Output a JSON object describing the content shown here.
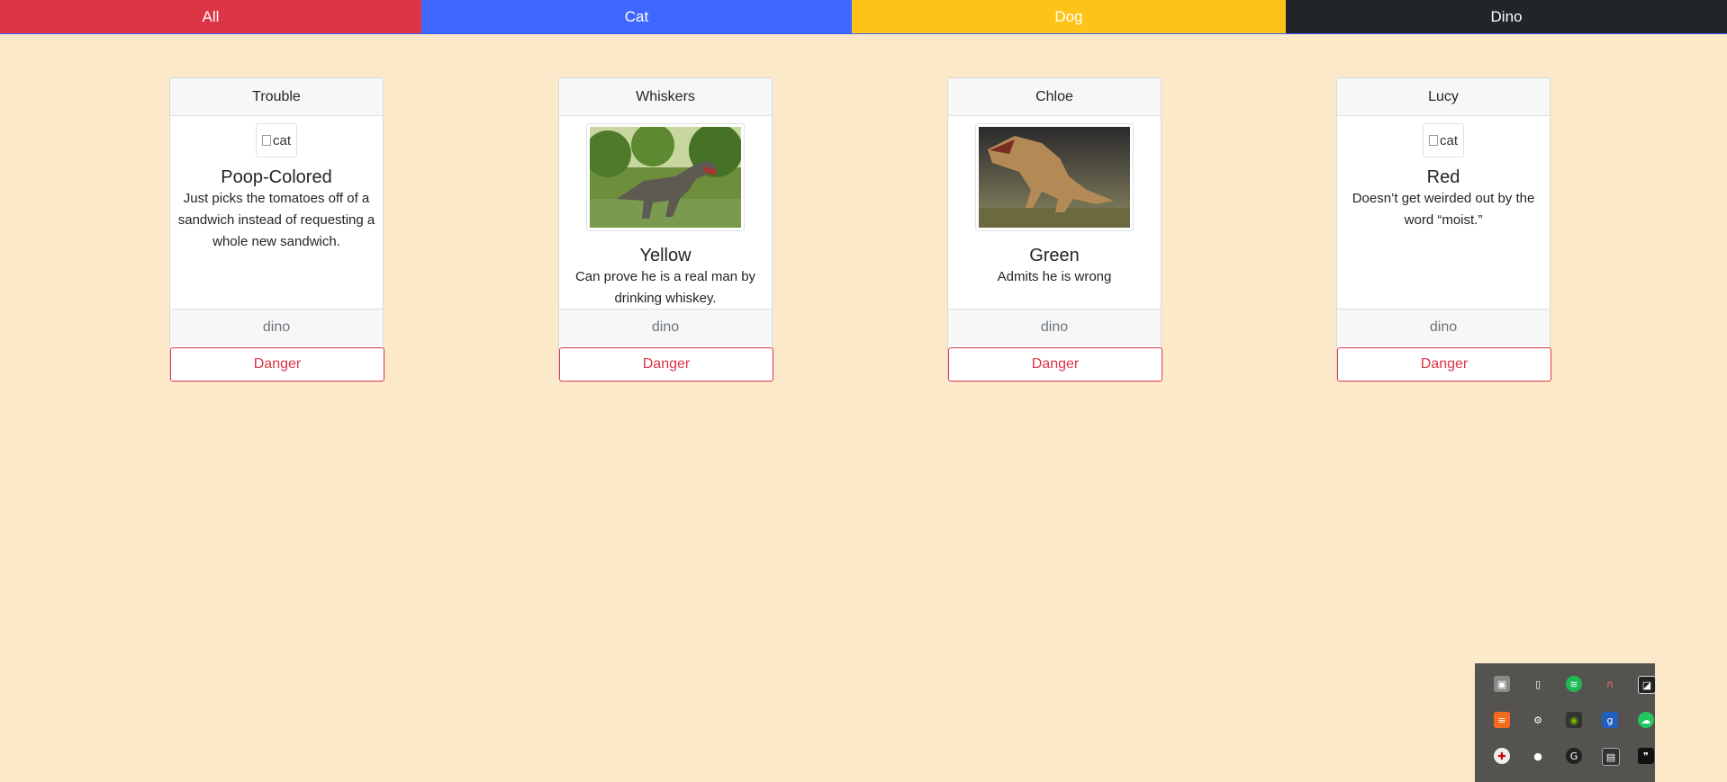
{
  "nav": {
    "all": "All",
    "cat": "Cat",
    "dog": "Dog",
    "dino": "Dino"
  },
  "cards": [
    {
      "name": "Trouble",
      "image": "broken",
      "image_alt": "cat",
      "color": "Poop-Colored",
      "desc": "Just picks the tomatoes off of a sandwich instead of requesting a whole new sandwich.",
      "type": "dino",
      "button": "Danger"
    },
    {
      "name": "Whiskers",
      "image": "dino-photo",
      "image_alt": "",
      "color": "Yellow",
      "desc": "Can prove he is a real man by drinking whiskey.",
      "type": "dino",
      "button": "Danger"
    },
    {
      "name": "Chloe",
      "image": "dino-photo",
      "image_alt": "",
      "color": "Green",
      "desc": "Admits he is wrong",
      "type": "dino",
      "button": "Danger"
    },
    {
      "name": "Lucy",
      "image": "broken",
      "image_alt": "cat",
      "color": "Red",
      "desc": "Doesn’t get weirded out by the word “moist.”",
      "type": "dino",
      "button": "Danger"
    }
  ],
  "colors": {
    "background": "#fbe9ca",
    "tab_all": "#dc3545",
    "tab_cat": "#3f66ff",
    "tab_dog": "#fcc419",
    "tab_dino": "#212529",
    "danger": "#dc3545"
  },
  "tray_icons": [
    "photos-icon",
    "usb-drive-icon",
    "spotify-icon",
    "bluetooth-magnet-icon",
    "display-brightness-icon",
    "orange-app-icon",
    "steam-icon",
    "nvidia-icon",
    "blue-app-icon",
    "green-cloud-icon",
    "shield-icon",
    "microphone-icon",
    "logitech-icon",
    "monitor-icon",
    "quote-icon"
  ]
}
